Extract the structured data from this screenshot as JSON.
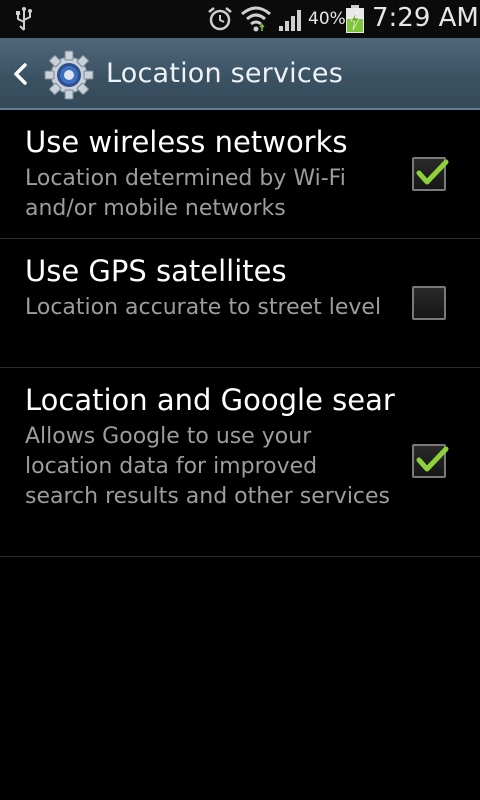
{
  "status_bar": {
    "battery_percent": "40%",
    "time": "7:29 AM",
    "icons": [
      "usb-icon",
      "alarm-icon",
      "wifi-icon",
      "signal-icon",
      "battery-charging-icon"
    ]
  },
  "header": {
    "title": "Location services",
    "icons": [
      "back-icon",
      "settings-gear-icon"
    ]
  },
  "settings": [
    {
      "title": "Use wireless networks",
      "summary": "Location determined by Wi-Fi and/or mobile networks",
      "checked": true
    },
    {
      "title": "Use GPS satellites",
      "summary": "Location accurate to street level",
      "checked": false
    },
    {
      "title": "Location and Google search",
      "summary": "Allows Google to use your location data for improved search results and other services",
      "checked": true
    }
  ],
  "colors": {
    "title_bar": "#3a5162",
    "check_mark": "#8fd13a",
    "summary_text": "#9d9d9d"
  }
}
